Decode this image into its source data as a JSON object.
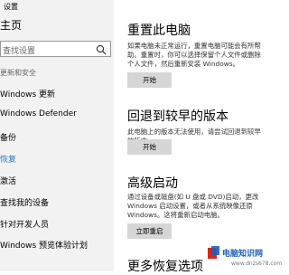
{
  "app": {
    "title": "设置"
  },
  "sidebar": {
    "page_title": "主页",
    "search_placeholder": "查找设置",
    "category": "更新和安全",
    "items": [
      {
        "label": "Windows 更新"
      },
      {
        "label": "Windows Defender"
      },
      {
        "label": "备份"
      },
      {
        "label": "恢复"
      },
      {
        "label": "激活"
      },
      {
        "label": "查找我的设备"
      },
      {
        "label": "针对开发人员"
      },
      {
        "label": "Windows 预览体验计划"
      }
    ]
  },
  "content": {
    "reset": {
      "title": "重置此电脑",
      "desc": "如果电脑未正常运行，重置电脑可能会有所帮助。重置时，你可以选择保留个人文件或删除个人文件，然后重新安装 Windows。",
      "button": "开始"
    },
    "rollback": {
      "title": "回退到较早的版本",
      "desc": "此电脑上的版本无法使用，请尝试回退到较早的版本。",
      "button": "开始"
    },
    "advanced": {
      "title": "高级启动",
      "desc": "通过设备或磁盘(如 U 盘或 DVD)启动，更改 Windows 启动设置，或者从系统映像还原 Windows。这将重新启动电脑。",
      "button": "立即重启"
    },
    "more": {
      "title": "更多恢复选项"
    }
  },
  "watermark": {
    "text": "电脑知识网",
    "url": "www.dnzs678.com"
  }
}
